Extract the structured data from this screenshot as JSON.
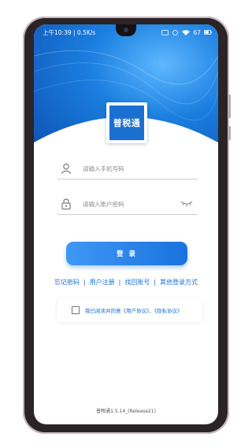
{
  "status_bar": {
    "left": "上午10:39 | 0.5K/s",
    "battery": "67"
  },
  "logo": {
    "text": "普税通"
  },
  "phone_field": {
    "placeholder": "请输入手机号码"
  },
  "password_field": {
    "placeholder": "请输入账户密码"
  },
  "login_button": {
    "label": "登 录"
  },
  "links": {
    "forgot": "忘记密码",
    "register": "用户注册",
    "recover": "找回账号",
    "other": "其他登录方式",
    "separator": "|"
  },
  "agreement": {
    "text": "我已阅读并同意《用户协议》、《隐私协议》"
  },
  "footer": {
    "version": "普税通1.5.14_(Release21)"
  },
  "colors": {
    "accent": "#1b6fd0",
    "button": "#2a83ea",
    "hero": "#1a7fe0"
  }
}
